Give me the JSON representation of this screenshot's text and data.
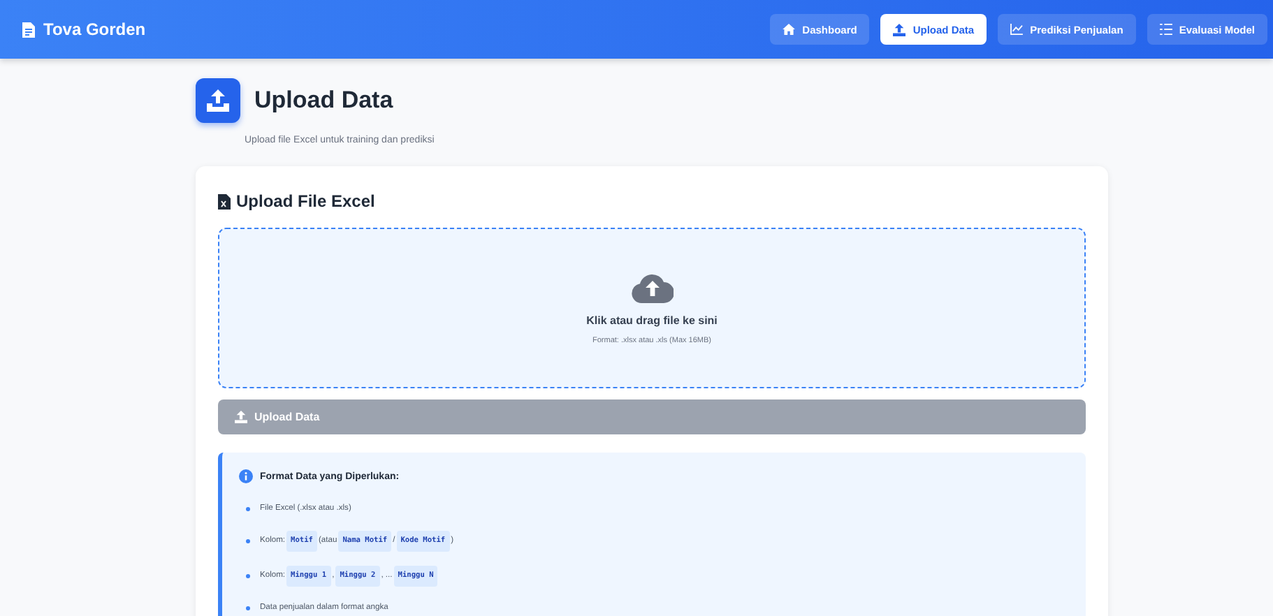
{
  "navbar": {
    "brand": "Tova Gorden",
    "links": [
      {
        "label": "Dashboard",
        "selected": false
      },
      {
        "label": "Upload Data",
        "selected": true
      },
      {
        "label": "Prediksi Penjualan",
        "selected": false
      },
      {
        "label": "Evaluasi Model",
        "selected": false
      }
    ]
  },
  "header": {
    "title": "Upload Data",
    "subtitle": "Upload file Excel untuk training dan prediksi"
  },
  "card": {
    "title": "Upload File Excel",
    "dropzone": {
      "text": "Klik atau drag file ke sini",
      "hint": "Format: .xlsx atau .xls (Max 16MB)"
    },
    "button": {
      "label": "Upload Data",
      "disabled": true
    },
    "info": {
      "title": "Format Data yang Diperlukan:",
      "items": [
        [
          {
            "kind": "text",
            "text": "File Excel (.xlsx atau .xls)"
          }
        ],
        [
          {
            "kind": "text",
            "text": "Kolom:"
          },
          {
            "kind": "code",
            "text": "Motif"
          },
          {
            "kind": "text",
            "text": "(atau"
          },
          {
            "kind": "code",
            "text": "Nama Motif"
          },
          {
            "kind": "text",
            "text": "/"
          },
          {
            "kind": "code",
            "text": "Kode Motif"
          },
          {
            "kind": "text",
            "text": ")"
          }
        ],
        [
          {
            "kind": "text",
            "text": "Kolom:"
          },
          {
            "kind": "code",
            "text": "Minggu 1"
          },
          {
            "kind": "text",
            "text": ","
          },
          {
            "kind": "code",
            "text": "Minggu 2"
          },
          {
            "kind": "text",
            "text": ", ..."
          },
          {
            "kind": "code",
            "text": "Minggu N"
          }
        ],
        [
          {
            "kind": "text",
            "text": "Data penjualan dalam format angka"
          }
        ]
      ]
    }
  }
}
